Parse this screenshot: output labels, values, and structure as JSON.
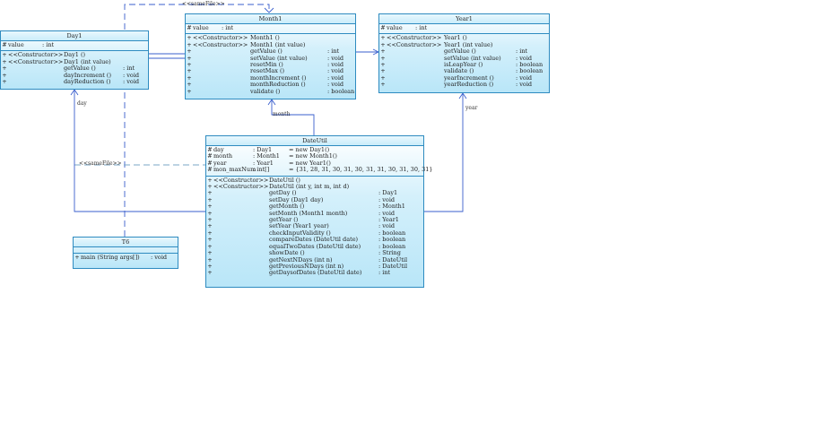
{
  "classes": {
    "day1": {
      "name": "Day1",
      "fields": [
        {
          "vis": "#",
          "name": "value",
          "type": ": int",
          "init": ""
        }
      ],
      "methods": [
        {
          "vis": "+",
          "a": "<<Constructor>>",
          "b": "Day1 ()",
          "c": ""
        },
        {
          "vis": "+",
          "a": "<<Constructor>>",
          "b": "Day1 (int value)",
          "c": ""
        },
        {
          "vis": "+",
          "a": "",
          "b": "getValue ()",
          "c": ": int"
        },
        {
          "vis": "+",
          "a": "",
          "b": "dayIncrement ()",
          "c": ": void"
        },
        {
          "vis": "+",
          "a": "",
          "b": "dayReduction ()",
          "c": ": void"
        }
      ]
    },
    "month1": {
      "name": "Month1",
      "fields": [
        {
          "vis": "#",
          "name": "value",
          "type": ": int",
          "init": ""
        }
      ],
      "methods": [
        {
          "vis": "+",
          "a": "<<Constructor>>",
          "b": "Month1 ()",
          "c": ""
        },
        {
          "vis": "+",
          "a": "<<Constructor>>",
          "b": "Month1 (int value)",
          "c": ""
        },
        {
          "vis": "+",
          "a": "",
          "b": "getValue ()",
          "c": ": int"
        },
        {
          "vis": "+",
          "a": "",
          "b": "setValue (int value)",
          "c": ": void"
        },
        {
          "vis": "+",
          "a": "",
          "b": "resetMin ()",
          "c": ": void"
        },
        {
          "vis": "+",
          "a": "",
          "b": "resetMax ()",
          "c": ": void"
        },
        {
          "vis": "+",
          "a": "",
          "b": "monthIncrement ()",
          "c": ": void"
        },
        {
          "vis": "+",
          "a": "",
          "b": "monthReduction ()",
          "c": ": void"
        },
        {
          "vis": "+",
          "a": "",
          "b": "validate ()",
          "c": ": boolean"
        }
      ]
    },
    "year1": {
      "name": "Year1",
      "fields": [
        {
          "vis": "#",
          "name": "value",
          "type": ": int",
          "init": ""
        }
      ],
      "methods": [
        {
          "vis": "+",
          "a": "<<Constructor>>",
          "b": "Year1 ()",
          "c": ""
        },
        {
          "vis": "+",
          "a": "<<Constructor>>",
          "b": "Year1 (int value)",
          "c": ""
        },
        {
          "vis": "+",
          "a": "",
          "b": "getValue ()",
          "c": ": int"
        },
        {
          "vis": "+",
          "a": "",
          "b": "setValue (int value)",
          "c": ": void"
        },
        {
          "vis": "+",
          "a": "",
          "b": "isLeapYear ()",
          "c": ": boolean"
        },
        {
          "vis": "+",
          "a": "",
          "b": "validate ()",
          "c": ": boolean"
        },
        {
          "vis": "+",
          "a": "",
          "b": "yearIncrement ()",
          "c": ": void"
        },
        {
          "vis": "+",
          "a": "",
          "b": "yearReduction ()",
          "c": ": void"
        }
      ]
    },
    "dateutil": {
      "name": "DateUtil",
      "fields": [
        {
          "vis": "#",
          "name": "day",
          "type": ": Day1",
          "init": "= new Day1()"
        },
        {
          "vis": "#",
          "name": "month",
          "type": ": Month1",
          "init": "= new Month1()"
        },
        {
          "vis": "#",
          "name": "year",
          "type": ": Year1",
          "init": "= new Year1()"
        },
        {
          "vis": "#",
          "name": "mon_maxNum",
          "type": ": int[]",
          "init": "= {31, 28, 31, 30, 31, 30, 31, 31, 30, 31, 30, 31}"
        }
      ],
      "methods": [
        {
          "vis": "+",
          "a": "<<Constructor>>",
          "b": "DateUtil ()",
          "c": ""
        },
        {
          "vis": "+",
          "a": "<<Constructor>>",
          "b": "DateUtil (int y, int m, int d)",
          "c": ""
        },
        {
          "vis": "+",
          "a": "",
          "b": "getDay ()",
          "c": ": Day1"
        },
        {
          "vis": "+",
          "a": "",
          "b": "setDay (Day1 day)",
          "c": ": void"
        },
        {
          "vis": "+",
          "a": "",
          "b": "getMonth ()",
          "c": ": Month1"
        },
        {
          "vis": "+",
          "a": "",
          "b": "setMonth (Month1 month)",
          "c": ": void"
        },
        {
          "vis": "+",
          "a": "",
          "b": "getYear ()",
          "c": ": Year1"
        },
        {
          "vis": "+",
          "a": "",
          "b": "setYear (Year1 year)",
          "c": ": void"
        },
        {
          "vis": "+",
          "a": "",
          "b": "checkInputValidity ()",
          "c": ": boolean"
        },
        {
          "vis": "+",
          "a": "",
          "b": "compareDates (DateUtil date)",
          "c": ": boolean"
        },
        {
          "vis": "+",
          "a": "",
          "b": "equalTwoDates (DateUtil date)",
          "c": ": boolean"
        },
        {
          "vis": "+",
          "a": "",
          "b": "showDate ()",
          "c": ": String"
        },
        {
          "vis": "+",
          "a": "",
          "b": "getNextNDays (int n)",
          "c": ": DateUtil"
        },
        {
          "vis": "+",
          "a": "",
          "b": "getPreviousNDays (int n)",
          "c": ": DateUtil"
        },
        {
          "vis": "+",
          "a": "",
          "b": "getDaysofDates (DateUtil date)",
          "c": ": int"
        }
      ]
    },
    "t6": {
      "name": "T6",
      "fields": [],
      "methods": [
        {
          "vis": "+",
          "a": "main (String args[])",
          "b": "",
          "c": ": void"
        }
      ]
    }
  },
  "labels": {
    "samefile_top": "<<sameFile>>",
    "samefile_left": "<<sameFile>>",
    "day": "day",
    "month": "month",
    "year": "year"
  },
  "colors": {
    "border": "#2e8bc0",
    "line": "#3a5fcd"
  }
}
